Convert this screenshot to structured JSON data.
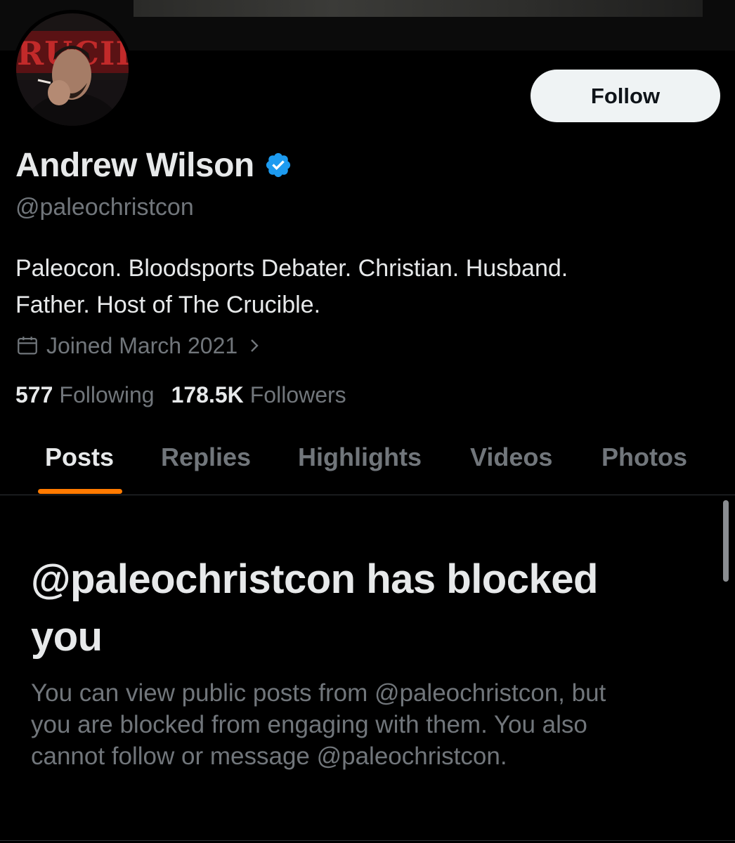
{
  "profile": {
    "display_name": "Andrew Wilson",
    "handle": "@paleochristcon",
    "bio_lines": [
      "Paleocon. Bloodsports Debater. Christian. Husband.",
      "Father. Host of The Crucible."
    ],
    "joined": "Joined March 2021",
    "verified_color": "#1d9bf0"
  },
  "actions": {
    "follow_label": "Follow"
  },
  "stats": {
    "following_count": "577",
    "following_label": "Following",
    "followers_count": "178.5K",
    "followers_label": "Followers"
  },
  "tabs": [
    {
      "label": "Posts",
      "active": true
    },
    {
      "label": "Replies",
      "active": false
    },
    {
      "label": "Highlights",
      "active": false
    },
    {
      "label": "Videos",
      "active": false
    },
    {
      "label": "Photos",
      "active": false
    }
  ],
  "blocked": {
    "title_lines": [
      "@paleochristcon has blocked",
      "you"
    ],
    "description_lines": [
      "You can view public posts from @paleochristcon, but",
      "you are blocked from engaging with them. You also",
      "cannot follow or message @paleochristcon."
    ]
  },
  "avatar": {
    "banner_text": "RUCIBL"
  },
  "colors": {
    "tab_indicator": "#ff7a00",
    "background": "#000000",
    "muted_text": "#71767b"
  },
  "icons": {
    "calendar": "calendar-icon",
    "chevron": "chevron-right-icon",
    "verified": "verified-badge-icon"
  }
}
